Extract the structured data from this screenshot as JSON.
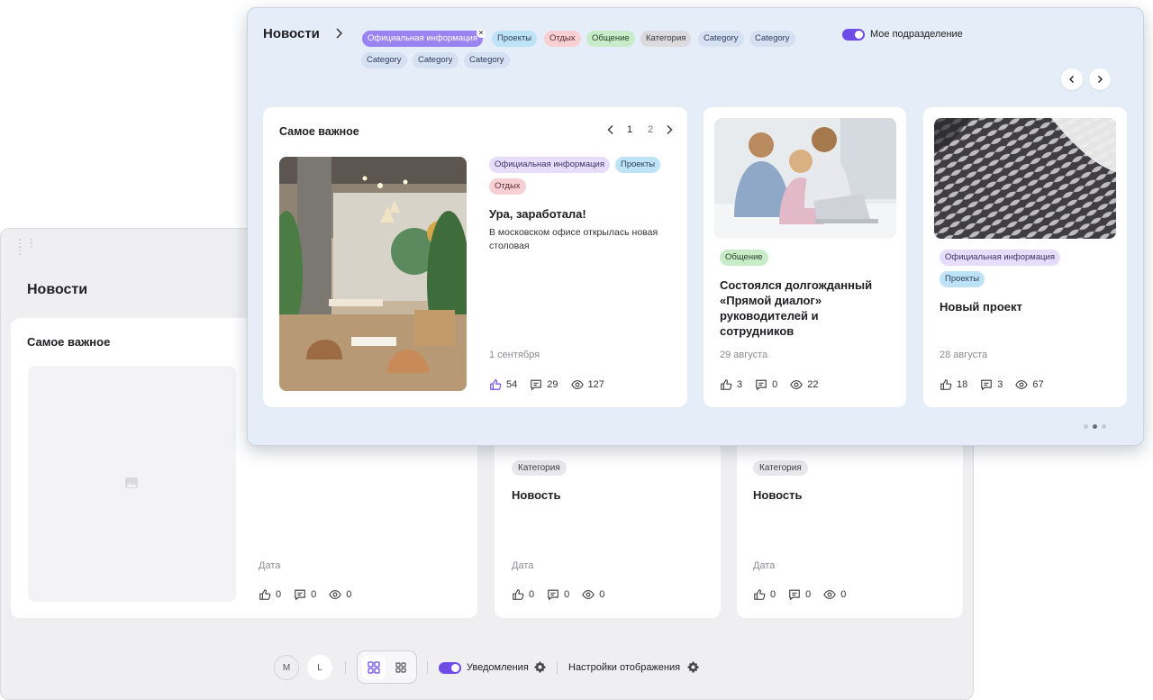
{
  "back": {
    "title": "Новости",
    "featured_title": "Самое важное",
    "main_card": {
      "date": "Дата",
      "likes": "0",
      "comments": "0",
      "views": "0"
    },
    "cards": [
      {
        "category": "Категория",
        "title": "Новость",
        "date": "Дата",
        "likes": "0",
        "comments": "0",
        "views": "0"
      },
      {
        "category": "Категория",
        "title": "Новость",
        "date": "Дата",
        "likes": "0",
        "comments": "0",
        "views": "0"
      }
    ],
    "controls": {
      "size_m": "M",
      "size_l": "L",
      "notifications_label": "Уведомления",
      "display_settings_label": "Настройки отображения"
    }
  },
  "front": {
    "title": "Новости",
    "filter_tags": [
      "Официальная информация",
      "Проекты",
      "Отдых",
      "Общение",
      "Категория",
      "Category",
      "Category",
      "Category",
      "Category",
      "Category"
    ],
    "toggle_label": "Мое подразделение",
    "featured": {
      "heading": "Самое важное",
      "pager": [
        "1",
        "2"
      ],
      "tags": [
        "Официальная информация",
        "Проекты",
        "Отдых"
      ],
      "title": "Ура, заработала!",
      "description": "В московском офисе открылась новая столовая",
      "date": "1 сентября",
      "likes": "54",
      "comments": "29",
      "views": "127"
    },
    "cards": [
      {
        "tags": [
          "Общение"
        ],
        "title": "Состоялся долгожданный «Прямой диалог» руководителей и сотрудников",
        "date": "29 августа",
        "likes": "3",
        "comments": "0",
        "views": "22"
      },
      {
        "tags": [
          "Официальная информация",
          "Проекты"
        ],
        "title": "Новый проект",
        "date": "28 августа",
        "likes": "18",
        "comments": "3",
        "views": "67"
      }
    ]
  },
  "colors": {
    "accent": "#6f4be8",
    "front_panel_bg": "#e4edf8",
    "back_panel_bg": "#efeff1"
  }
}
